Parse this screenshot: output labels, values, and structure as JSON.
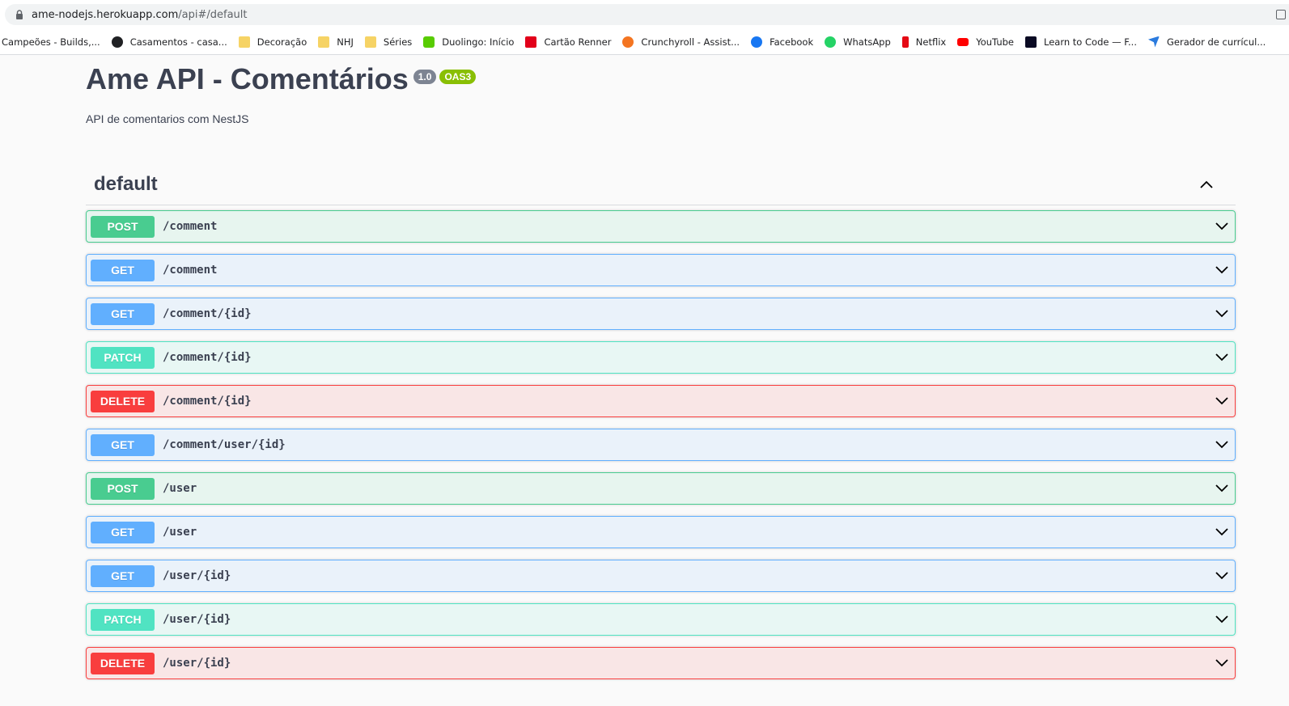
{
  "browser": {
    "url_host": "ame-nodejs.herokuapp.com",
    "url_path": "/api#/default",
    "bookmarks": [
      {
        "label": "Campeões - Builds,...",
        "icon": "none"
      },
      {
        "label": "Casamentos - casa...",
        "icon": "globe-icon"
      },
      {
        "label": "Decoração",
        "icon": "folder-icon"
      },
      {
        "label": "NHJ",
        "icon": "folder-icon"
      },
      {
        "label": "Séries",
        "icon": "folder-icon"
      },
      {
        "label": "Duolingo: Início",
        "icon": "duolingo-icon"
      },
      {
        "label": "Cartão Renner",
        "icon": "renner-icon"
      },
      {
        "label": "Crunchyroll - Assist...",
        "icon": "crunchyroll-icon"
      },
      {
        "label": "Facebook",
        "icon": "facebook-icon"
      },
      {
        "label": "WhatsApp",
        "icon": "whatsapp-icon"
      },
      {
        "label": "Netflix",
        "icon": "netflix-icon"
      },
      {
        "label": "YouTube",
        "icon": "youtube-icon"
      },
      {
        "label": "Learn to Code — F...",
        "icon": "freecodecamp-icon"
      },
      {
        "label": "Gerador de currícul...",
        "icon": "arrow-icon"
      }
    ]
  },
  "api": {
    "title": "Ame API - Comentários",
    "version": "1.0",
    "spec": "OAS3",
    "description": "API de comentarios com NestJS"
  },
  "section": {
    "name": "default"
  },
  "colors": {
    "post": "#49cc90",
    "get": "#61affe",
    "patch": "#50e3c2",
    "delete": "#f93e3e"
  },
  "operations": [
    {
      "method": "POST",
      "path": "/comment"
    },
    {
      "method": "GET",
      "path": "/comment"
    },
    {
      "method": "GET",
      "path": "/comment/{id}"
    },
    {
      "method": "PATCH",
      "path": "/comment/{id}"
    },
    {
      "method": "DELETE",
      "path": "/comment/{id}"
    },
    {
      "method": "GET",
      "path": "/comment/user/{id}"
    },
    {
      "method": "POST",
      "path": "/user"
    },
    {
      "method": "GET",
      "path": "/user"
    },
    {
      "method": "GET",
      "path": "/user/{id}"
    },
    {
      "method": "PATCH",
      "path": "/user/{id}"
    },
    {
      "method": "DELETE",
      "path": "/user/{id}"
    }
  ]
}
